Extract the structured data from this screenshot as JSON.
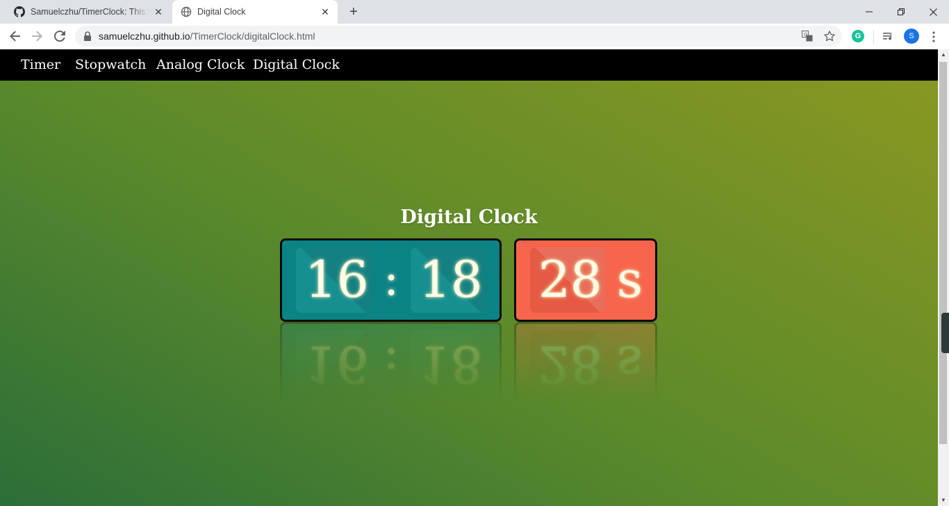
{
  "browser": {
    "tabs": [
      {
        "title": "Samuelczhu/TimerClock: This w",
        "icon": "github-icon",
        "active": false
      },
      {
        "title": "Digital Clock",
        "icon": "globe-icon",
        "active": true
      }
    ],
    "new_tab_symbol": "+",
    "close_symbol": "✕",
    "address": {
      "host": "samuelczhu.github.io",
      "path": "/TimerClock/digitalClock.html"
    },
    "profile_initial": "S",
    "grammarly_initial": "G"
  },
  "site_nav": {
    "items": [
      "Timer",
      "Stopwatch",
      "Analog Clock",
      "Digital Clock"
    ]
  },
  "clock": {
    "title": "Digital Clock",
    "hours": "16",
    "separator": ":",
    "minutes": "18",
    "seconds": "28",
    "seconds_unit": "s"
  },
  "colors": {
    "hm_panel": "#0b8385",
    "seconds_panel": "#f7654c",
    "nav_bar": "#000000",
    "background_start": "#2c6e38",
    "background_end": "#8b9821"
  }
}
